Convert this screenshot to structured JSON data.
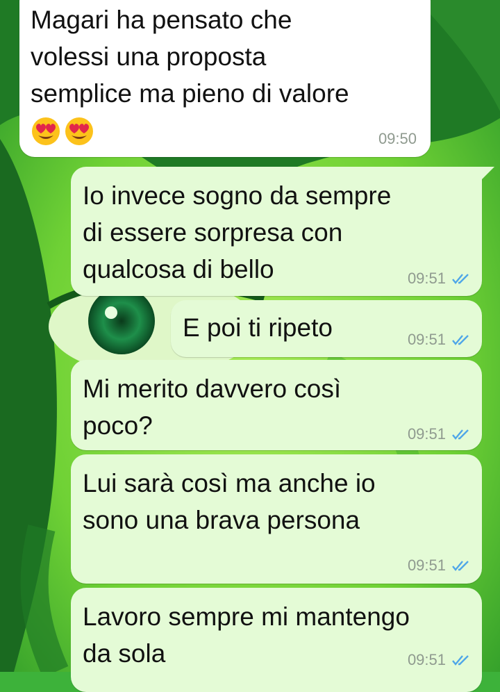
{
  "messages": [
    {
      "direction": "incoming",
      "text": "Magari ha pensato che\nvolessi una proposta\nsemplice ma pieno di valore",
      "emoji": [
        "heart-eyes-emoji",
        "heart-eyes-emoji"
      ],
      "time": "09:50"
    },
    {
      "direction": "outgoing",
      "text": "Io invece sogno da sempre\ndi essere sorpresa con\nqualcosa di bello",
      "time": "09:51",
      "status": "read"
    },
    {
      "direction": "outgoing",
      "text": "E poi ti ripeto",
      "time": "09:51",
      "status": "read"
    },
    {
      "direction": "outgoing",
      "text": "Mi merito davvero così\npoco?",
      "time": "09:51",
      "status": "read"
    },
    {
      "direction": "outgoing",
      "text": "Lui sarà così ma anche io\nsono una brava persona",
      "time": "09:51",
      "status": "read"
    },
    {
      "direction": "outgoing",
      "text": "Lavoro sempre mi mantengo\nda sola",
      "time": "09:51",
      "status": "read"
    }
  ],
  "colors": {
    "incoming_bubble": "#ffffff",
    "outgoing_bubble": "#e4fbd6",
    "read_check": "#4fa6e8",
    "wallpaper": "#3db23a"
  }
}
